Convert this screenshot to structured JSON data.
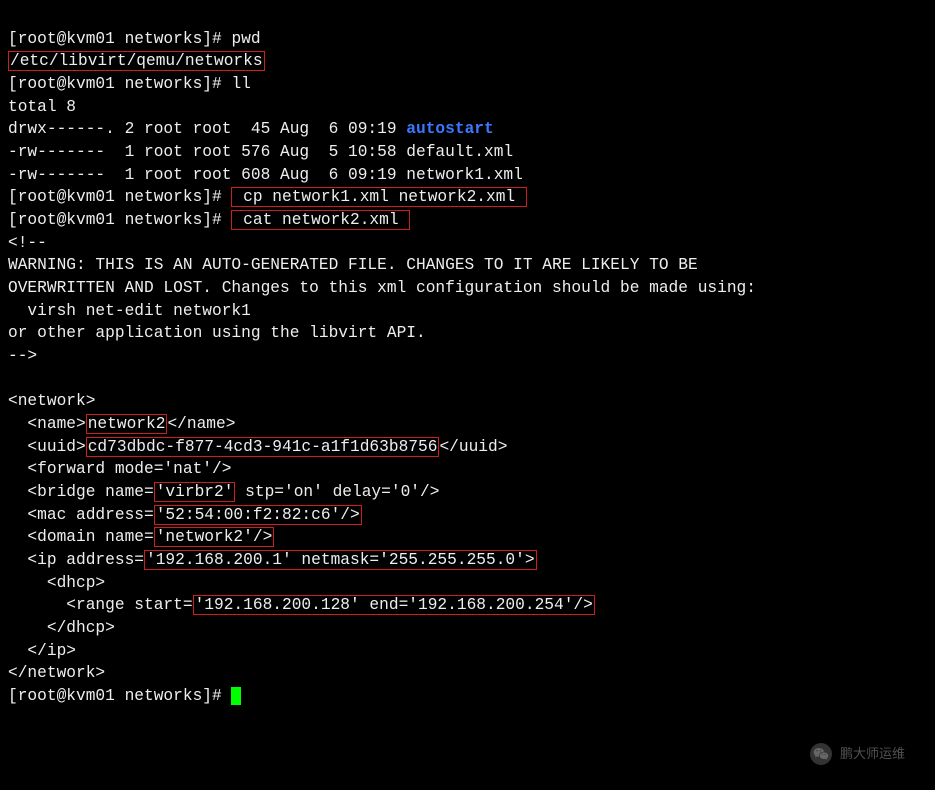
{
  "prompt": "[root@kvm01 networks]# ",
  "cmd_pwd": "pwd",
  "pwd_output": "/etc/libvirt/qemu/networks",
  "cmd_ll": "ll",
  "ll_total": "total 8",
  "ll_row1_a": "drwx------. 2 root root  45 Aug  6 09:19 ",
  "ll_row1_name": "autostart",
  "ll_row2": "-rw-------  1 root root 576 Aug  5 10:58 default.xml",
  "ll_row3": "-rw-------  1 root root 608 Aug  6 09:19 network1.xml",
  "cmd_cp": " cp network1.xml network2.xml ",
  "cmd_cat": " cat network2.xml ",
  "xml_comment_open": "<!--",
  "xml_warn1": "WARNING: THIS IS AN AUTO-GENERATED FILE. CHANGES TO IT ARE LIKELY TO BE",
  "xml_warn2": "OVERWRITTEN AND LOST. Changes to this xml configuration should be made using:",
  "xml_warn3": "  virsh net-edit network1",
  "xml_warn4": "or other application using the libvirt API.",
  "xml_comment_close": "-->",
  "xml_net_open": "<network>",
  "xml_name_pre": "  <name>",
  "xml_name_val": "network2",
  "xml_name_post": "</name>",
  "xml_uuid_pre": "  <uuid>",
  "xml_uuid_val": "cd73dbdc-f877-4cd3-941c-a1f1d63b8756",
  "xml_uuid_post": "</uuid>",
  "xml_forward": "  <forward mode='nat'/>",
  "xml_bridge_pre": "  <bridge name=",
  "xml_bridge_val": "'virbr2'",
  "xml_bridge_post": " stp='on' delay='0'/>",
  "xml_mac_pre": "  <mac address=",
  "xml_mac_val": "'52:54:00:f2:82:c6'/>",
  "xml_domain_pre": "  <domain name=",
  "xml_domain_val": "'network2'/>",
  "xml_ip_pre": "  <ip address=",
  "xml_ip_val": "'192.168.200.1' netmask='255.255.255.0'>",
  "xml_dhcp_open": "    <dhcp>",
  "xml_range_pre": "      <range start=",
  "xml_range_val": "'192.168.200.128' end='192.168.200.254'/>",
  "xml_dhcp_close": "    </dhcp>",
  "xml_ip_close": "  </ip>",
  "xml_net_close": "</network>",
  "watermark_text": "鹏大师运维"
}
